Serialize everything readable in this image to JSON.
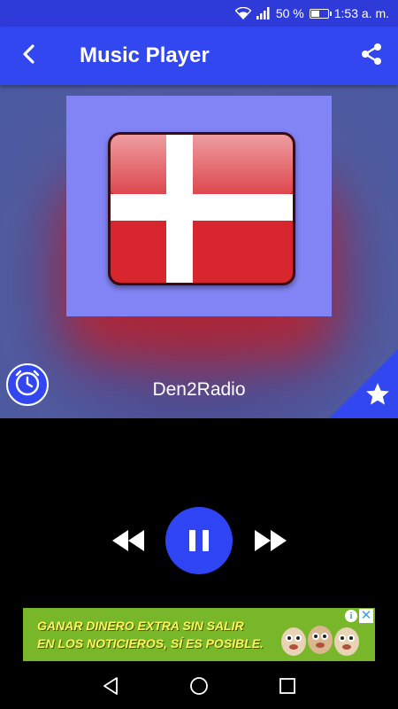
{
  "status_bar": {
    "battery_percent_text": "50 %",
    "battery_level": 0.5,
    "time": "1:53 a. m.",
    "icons": [
      "wifi-icon",
      "signal-icon",
      "battery-icon"
    ]
  },
  "app_bar": {
    "title": "Music Player",
    "back_icon": "back-arrow-icon",
    "share_icon": "share-icon"
  },
  "now_playing": {
    "station_name": "Den2Radio",
    "artwork": "denmark-flag",
    "alarm_icon": "clock-icon",
    "favorite_icon": "star-icon"
  },
  "player_controls": {
    "rewind_icon": "rewind-icon",
    "state_icon": "pause-icon",
    "forward_icon": "fast-forward-icon"
  },
  "ad_banner": {
    "line1": "GANAR DINERO EXTRA SIN SALIR",
    "line2": "EN LOS NOTICIEROS, SÍ ES POSIBLE.",
    "info_glyph": "i",
    "close_glyph": "✕"
  },
  "nav_bar": {
    "icons": [
      "back-triangle-icon",
      "home-circle-icon",
      "recents-square-icon"
    ]
  },
  "colors": {
    "primary": "#3347f0",
    "status_bar": "#2f3bd8",
    "artwork_bg": "#8283f4",
    "flag_red": "#d8262e",
    "ad_green": "#78b62a",
    "ad_text": "#fff55a"
  }
}
